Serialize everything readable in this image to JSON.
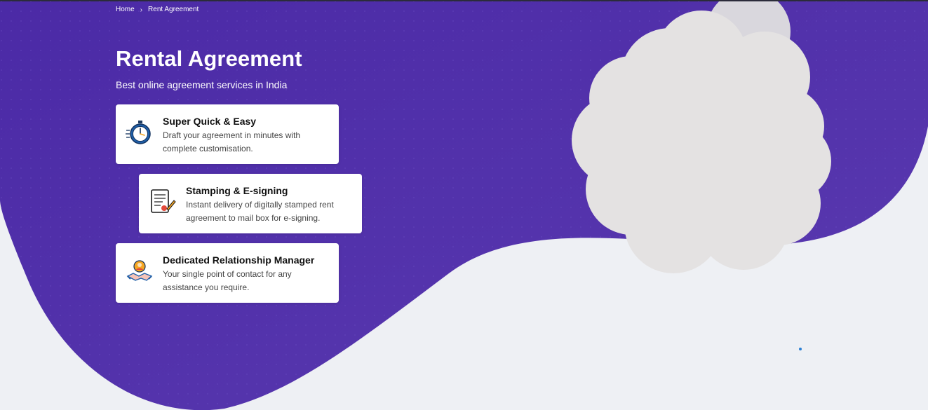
{
  "breadcrumb": {
    "home": "Home",
    "current": "Rent Agreement"
  },
  "hero": {
    "title": "Rental Agreement",
    "subtitle": "Best online agreement services in India"
  },
  "features": [
    {
      "icon": "stopwatch-icon",
      "title": "Super Quick & Easy",
      "description": "Draft your agreement in minutes with complete customisation."
    },
    {
      "icon": "document-sign-icon",
      "title": "Stamping & E-signing",
      "description": "Instant delivery of digitally stamped rent agreement to mail box for e-signing."
    },
    {
      "icon": "handshake-person-icon",
      "title": "Dedicated Relationship Manager",
      "description": "Your single point of contact for any assistance you require."
    }
  ],
  "colors": {
    "brand_purple": "#4a2ea0",
    "background": "#eef0f4",
    "card_bg": "#ffffff",
    "icon_blue": "#1f5fa8",
    "icon_orange": "#f5a623"
  }
}
